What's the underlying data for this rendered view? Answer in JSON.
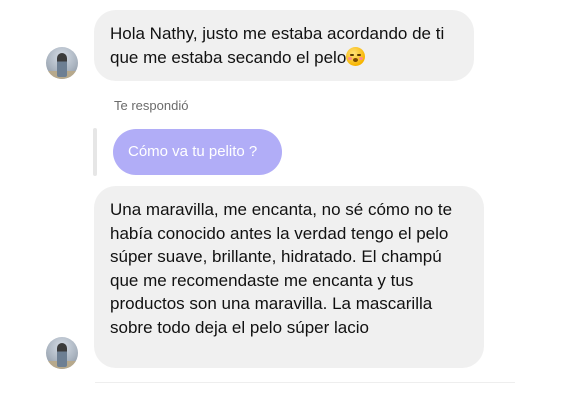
{
  "messages": [
    {
      "text_main": "Hola Nathy, justo me estaba acordando de ti que me estaba secando el pelo",
      "emoji": "flushed-face-emoji"
    },
    {
      "text": "Una maravilla, me encanta, no sé cómo no te había conocido antes la verdad tengo el pelo súper suave, brillante, hidratado. El champú que me recomendaste me encanta y tus productos son una maravilla. La mascarilla sobre todo deja el pelo súper lacio"
    }
  ],
  "reply": {
    "label": "Te respondió",
    "quoted_text": "Cómo va tu pelito ?"
  },
  "colors": {
    "incoming_bubble": "#f0f0f0",
    "reply_bubble": "#b1adf7",
    "reply_text": "#ffffff",
    "label": "#6b6b6b"
  }
}
